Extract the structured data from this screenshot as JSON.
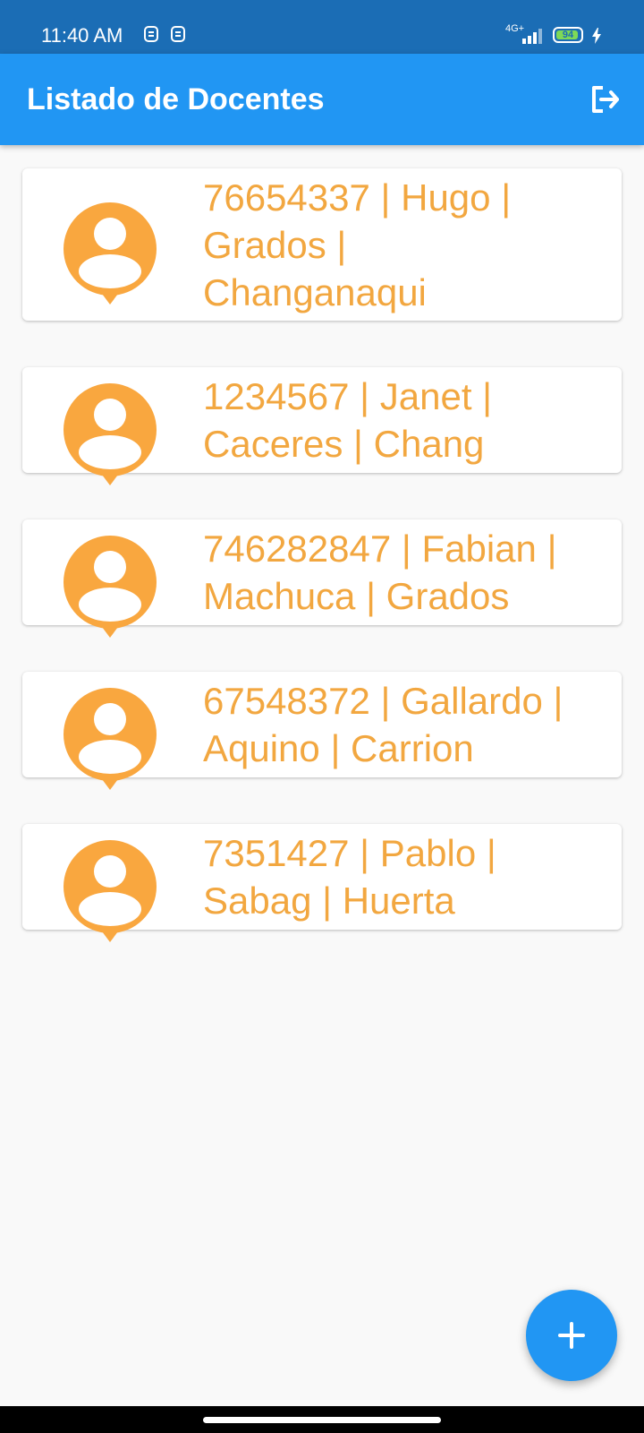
{
  "status": {
    "time": "11:40 AM",
    "network": "4G+",
    "battery": "94",
    "battery_level": 0.94
  },
  "appbar": {
    "title": "Listado de Docentes"
  },
  "teachers": [
    {
      "line1": "76654337 | Hugo |",
      "line2": "Grados |",
      "line3": "Changanaqui"
    },
    {
      "line1": "1234567 | Janet |",
      "line2": "Caceres | Chang"
    },
    {
      "line1": "746282847 | Fabian |",
      "line2": "Machuca | Grados"
    },
    {
      "line1": "67548372 | Gallardo |",
      "line2": "Aquino | Carrion"
    },
    {
      "line1": "7351427 | Pablo  |",
      "line2": "Sabag | Huerta"
    }
  ],
  "icons": {
    "logout": "logout-icon",
    "avatar": "person-pin-icon",
    "add": "plus-icon"
  },
  "colors": {
    "status_bar": "#1b6db5",
    "primary": "#2196f3",
    "accent_orange": "#f2a740",
    "background": "#f9f9f9"
  }
}
